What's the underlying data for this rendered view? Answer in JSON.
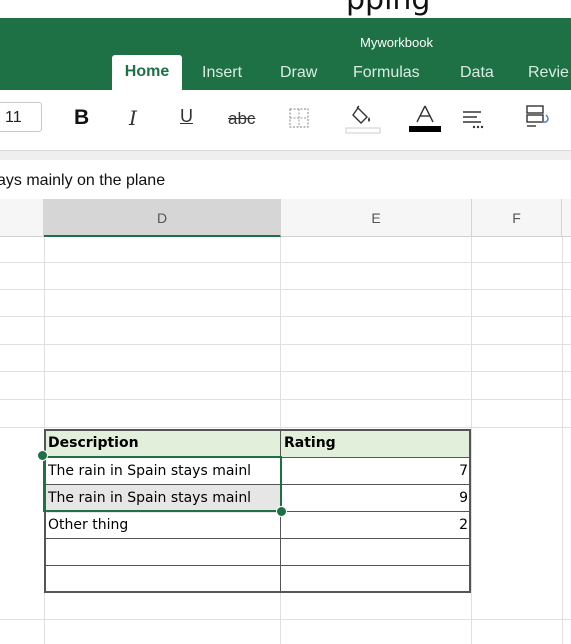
{
  "top_strip": {
    "partial_text": "pping"
  },
  "workbook_title": "Myworkbook",
  "tabs": [
    "Home",
    "Insert",
    "Draw",
    "Formulas",
    "Data",
    "Revie"
  ],
  "toolbar": {
    "font_size": "11",
    "bold": "B",
    "italic": "I",
    "underline": "U",
    "strikethrough": "abc",
    "font_color_letter": "A",
    "icons": [
      "borders-icon",
      "fill-color-icon",
      "font-color-icon",
      "align-icon",
      "wrap-text-icon"
    ]
  },
  "formula_bar": {
    "text": "ays mainly on the plane"
  },
  "sheet": {
    "column_headers": [
      "D",
      "E",
      "F"
    ],
    "selected_column": "D",
    "table": {
      "headers": [
        "Description",
        "Rating"
      ],
      "rows": [
        [
          "The rain in Spain stays mainl",
          "7"
        ],
        [
          "The rain in Spain stays mainl",
          "9"
        ],
        [
          "Other thing",
          "2"
        ],
        [
          "",
          ""
        ],
        [
          "",
          ""
        ]
      ]
    }
  },
  "colors": {
    "ribbon": "#1e7145",
    "table_header_fill": "#e2efda",
    "selection": "#1e7145"
  }
}
